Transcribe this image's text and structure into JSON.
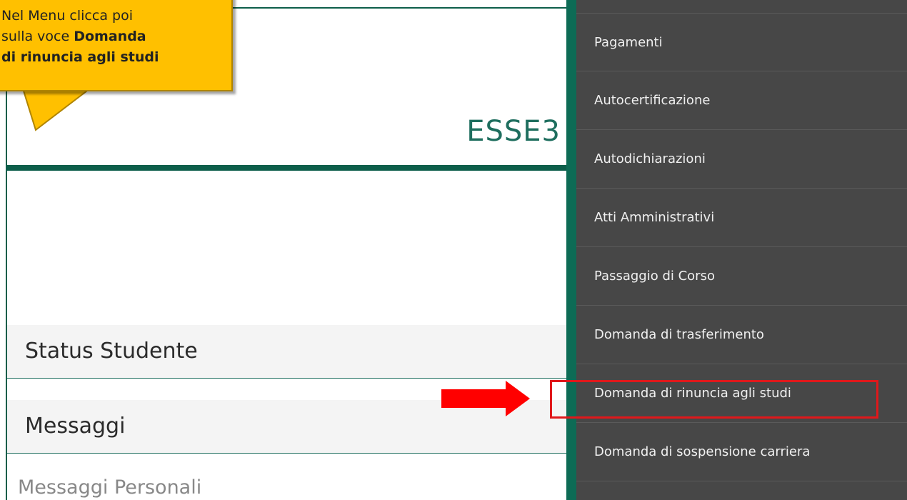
{
  "app": {
    "title": "ESSE3"
  },
  "main": {
    "sections": [
      {
        "heading": "Status Studente"
      },
      {
        "heading": "Messaggi"
      }
    ],
    "messages_personal": "Messaggi Personali"
  },
  "sidebar": {
    "items": [
      {
        "label": "Pagamenti"
      },
      {
        "label": "Autocertificazione"
      },
      {
        "label": "Autodichiarazioni"
      },
      {
        "label": "Atti Amministrativi"
      },
      {
        "label": "Passaggio di Corso"
      },
      {
        "label": "Domanda di trasferimento"
      },
      {
        "label": "Domanda di rinuncia agli studi"
      },
      {
        "label": "Domanda di sospensione carriera"
      }
    ]
  },
  "callout": {
    "line1": "Nel Menu clicca poi",
    "line2_prefix": "sulla voce ",
    "line2_bold": "Domanda",
    "line3_bold": "di rinuncia agli studi"
  },
  "colors": {
    "brand_green": "#0d6b55",
    "menu_background": "#474747",
    "callout_yellow": "#ffc000",
    "highlight_red": "#e0181b"
  },
  "icons": {
    "pointer_arrow": "right-arrow-icon"
  }
}
